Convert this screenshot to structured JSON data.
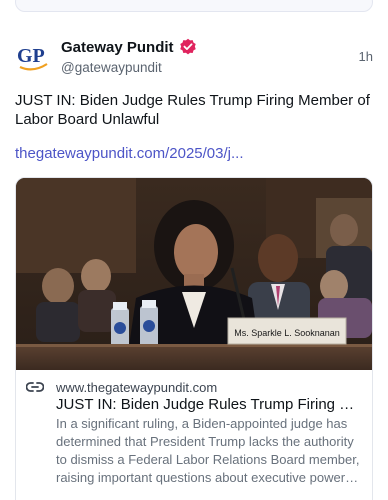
{
  "post": {
    "author_name": "Gateway Pundit",
    "handle": "@gatewaypundit",
    "time": "1h",
    "avatar_text": "GP",
    "text": "JUST IN: Biden Judge Rules Trump Firing Member of Labor Board Unlawful",
    "link": "thegatewaypundit.com/2025/03/j..."
  },
  "card": {
    "image_caption": "Ms. Sparkle L. Sooknanan",
    "domain": "www.thegatewaypundit.com",
    "title": "JUST IN: Biden Judge Rules Trump Firing Mem...",
    "description": "In a significant ruling, a Biden-appointed judge has determined that President Trump lacks the authority to dismiss a Federal Labor Relations Board member, raising important questions about executive power an..."
  },
  "icons": {
    "verified": "verified-badge-icon",
    "link": "link-icon"
  },
  "colors": {
    "accent": "#4d55c7",
    "verified": "#e0245e",
    "avatar_blue": "#1f3f8f",
    "avatar_orange": "#f0a020"
  }
}
